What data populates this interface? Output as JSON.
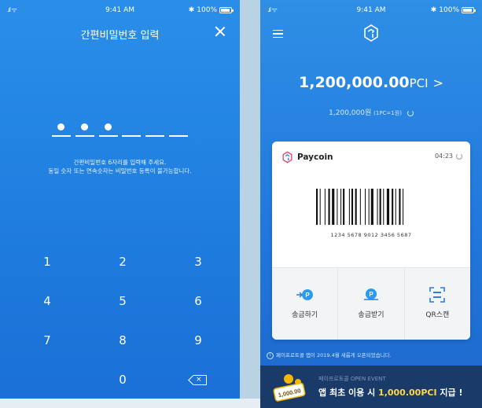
{
  "colors": {
    "accent_blue": "#1f7ddf",
    "banner_navy": "#1a3a6a",
    "highlight_yellow": "#ffd84a"
  },
  "left_phone": {
    "status": {
      "time": "9:41 AM",
      "battery": "100%"
    },
    "title": "간편비밀번호 입력",
    "pin_slots": [
      true,
      true,
      true,
      false,
      false,
      false
    ],
    "guide_line1": "간편비밀번호 6자리를 입력해 주세요.",
    "guide_line2": "동일 숫자 또는 연속숫자는 비밀번호 등록이 불가능합니다.",
    "keys": [
      [
        "1",
        "2",
        "3"
      ],
      [
        "4",
        "5",
        "6"
      ],
      [
        "7",
        "8",
        "9"
      ],
      [
        "",
        "0",
        "⌫"
      ]
    ]
  },
  "right_phone": {
    "status": {
      "time": "9:41 AM",
      "battery": "100%"
    },
    "balance_amount": "1,200,000.00",
    "balance_unit": "PCI",
    "krw_amount": "1,200,000원",
    "krw_rate": "(1PC=1원)",
    "card": {
      "brand": "Paycoin",
      "timer": "04:23",
      "barcode_number": "1234 5678 9012 3456 5687"
    },
    "actions": [
      {
        "label": "송금하기",
        "icon": "send-icon"
      },
      {
        "label": "송금받기",
        "icon": "receive-icon"
      },
      {
        "label": "QR스캔",
        "icon": "qr-scan-icon"
      }
    ],
    "notice": "페이프로토콜 앱이 2019.4월 새롭게 오픈되었습니다.",
    "banner": {
      "subtitle": "페이프로토콜 OPEN EVENT",
      "coin_label": "1,000.00",
      "main_prefix": "앱 최초 이용 시 ",
      "main_highlight": "1,000.00PCI",
      "main_suffix": " 지급 !"
    }
  }
}
